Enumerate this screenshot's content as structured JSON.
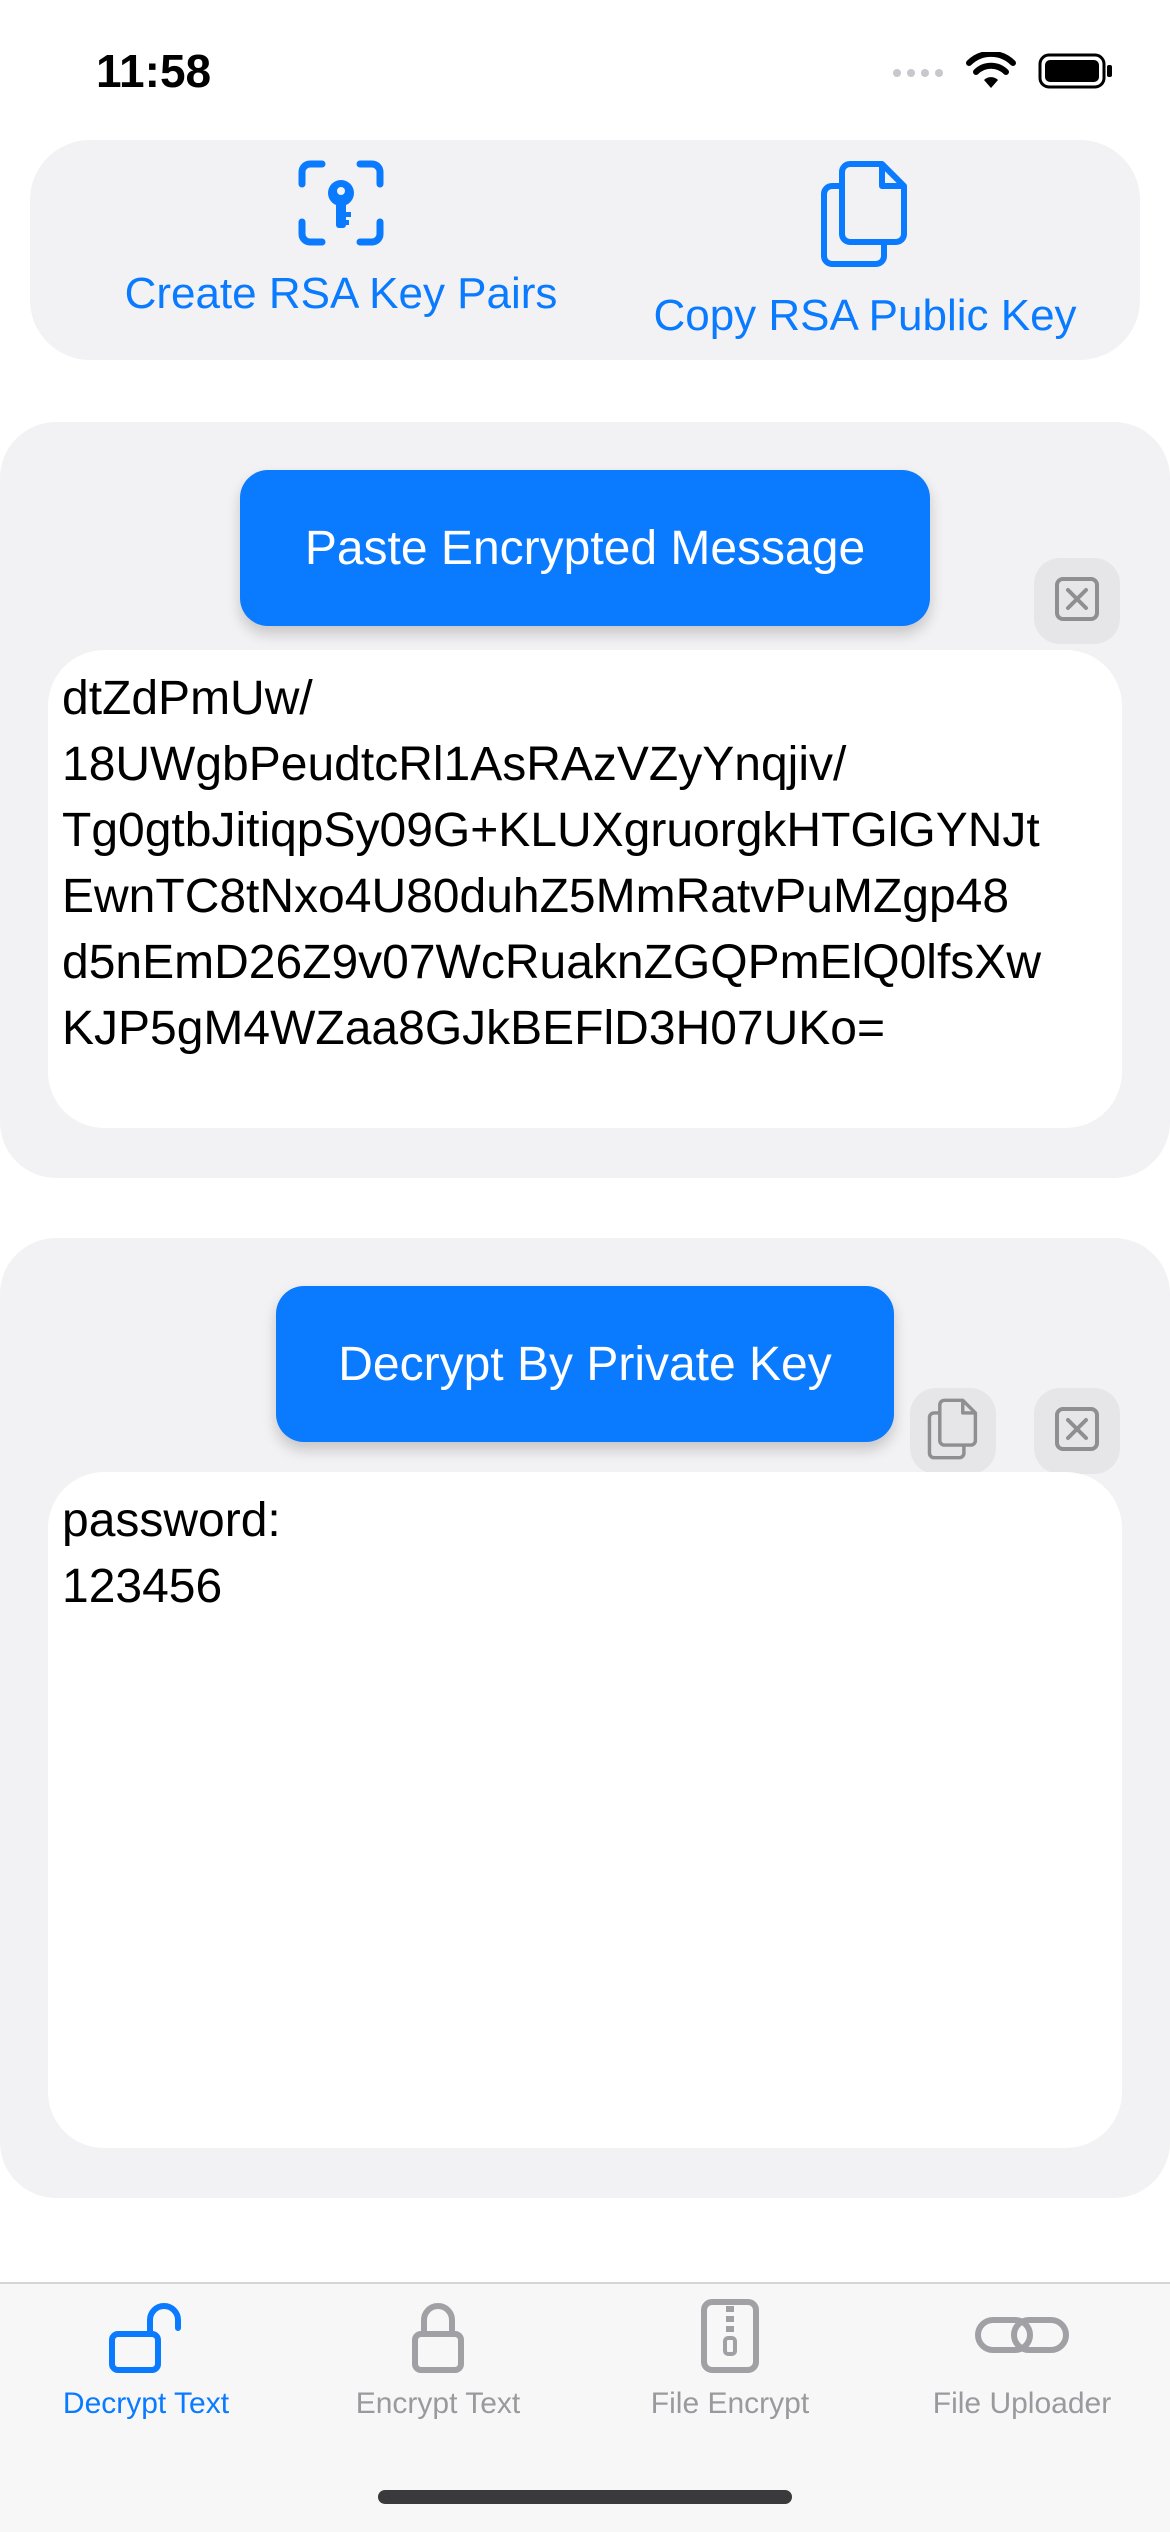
{
  "status_bar": {
    "time": "11:58"
  },
  "top_actions": {
    "create_key_label": "Create RSA Key Pairs",
    "copy_key_label": "Copy RSA Public Key"
  },
  "encrypted_panel": {
    "paste_button_label": "Paste Encrypted Message",
    "message": "dtZdPmUw/\n18UWgbPeudtcRl1AsRAzVZyYnqjiv/\nTg0gtbJitiqpSy09G+KLUXgruorgkHTGlGYNJt\nEwnTC8tNxo4U80duhZ5MmRatvPuMZgp48\nd5nEmD26Z9v07WcRuaknZGQPmElQ0lfsXw\nKJP5gM4WZaa8GJkBEFlD3H07UKo="
  },
  "decrypted_panel": {
    "decrypt_button_label": "Decrypt By Private Key",
    "result": "password:\n123456"
  },
  "tab_bar": {
    "tabs": [
      {
        "label": "Decrypt Text",
        "icon": "lock-open-icon",
        "active": true
      },
      {
        "label": "Encrypt Text",
        "icon": "lock-icon",
        "active": false
      },
      {
        "label": "File Encrypt",
        "icon": "zipper-file-icon",
        "active": false
      },
      {
        "label": "File Uploader",
        "icon": "link-icon",
        "active": false
      }
    ]
  },
  "colors": {
    "accent": "#0a7aff",
    "panel_background": "#f2f2f4",
    "inactive_tab": "#9a9a9e"
  }
}
